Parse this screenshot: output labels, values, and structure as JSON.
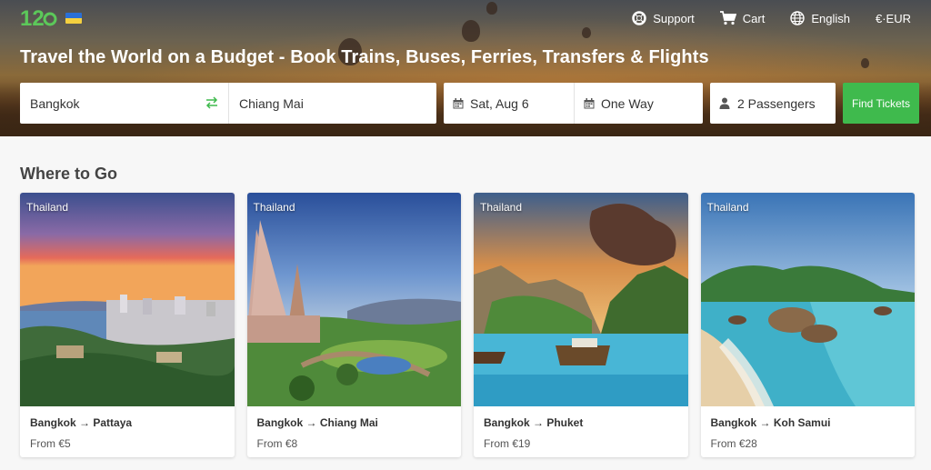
{
  "header": {
    "logo_text": "12Go",
    "nav": [
      {
        "label": "Support",
        "icon": "lifebuoy-icon"
      },
      {
        "label": "Cart",
        "icon": "cart-icon"
      },
      {
        "label": "English",
        "icon": "globe-icon"
      },
      {
        "label": "€·EUR",
        "icon": ""
      }
    ]
  },
  "hero": {
    "title": "Travel the World on a Budget - Book Trains, Buses, Ferries, Transfers & Flights"
  },
  "search": {
    "from": "Bangkok",
    "to": "Chiang Mai",
    "date": "Sat, Aug 6",
    "trip_type": "One Way",
    "passengers": "2 Passengers",
    "button_label": "Find Tickets"
  },
  "where_to_go": {
    "title": "Where to Go",
    "cards": [
      {
        "country": "Thailand",
        "route": "Bangkok → Pattaya",
        "price": "From €5"
      },
      {
        "country": "Thailand",
        "route": "Bangkok → Chiang Mai",
        "price": "From €8"
      },
      {
        "country": "Thailand",
        "route": "Bangkok → Phuket",
        "price": "From €19"
      },
      {
        "country": "Thailand",
        "route": "Bangkok → Koh Samui",
        "price": "From €28"
      }
    ]
  },
  "colors": {
    "accent_green": "#3fba4d",
    "flag_blue": "#2a6fd6",
    "flag_yellow": "#f4d03f"
  }
}
